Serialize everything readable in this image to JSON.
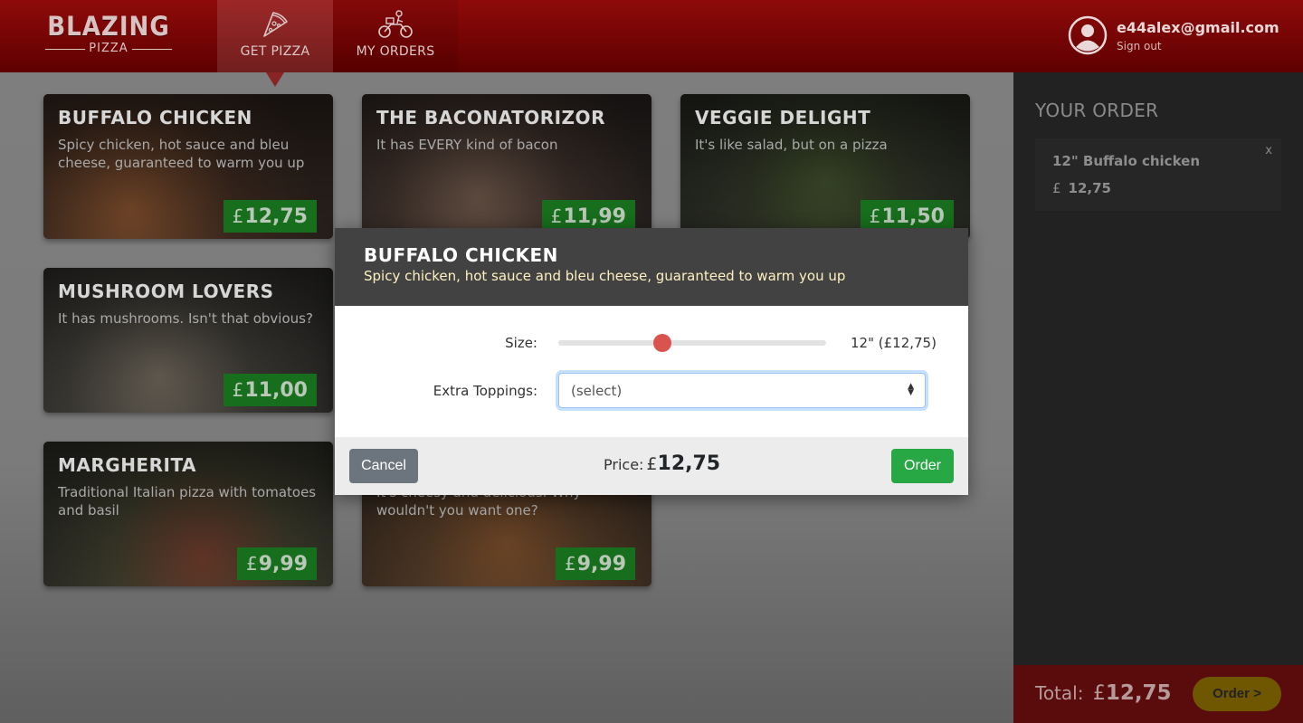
{
  "brand": {
    "top": "BLAZING",
    "bottom": "PIZZA"
  },
  "nav": {
    "get_pizza": "GET PIZZA",
    "my_orders": "MY ORDERS"
  },
  "user": {
    "email": "e44alex@gmail.com",
    "sign_out": "Sign out"
  },
  "specials": [
    {
      "name": "BUFFALO CHICKEN",
      "description": "Spicy chicken, hot sauce and bleu cheese, guaranteed to warm you up",
      "currency": "£",
      "price": "12,75"
    },
    {
      "name": "THE BACONATORIZOR",
      "description": "It has EVERY kind of bacon",
      "currency": "£",
      "price": "11,99"
    },
    {
      "name": "VEGGIE DELIGHT",
      "description": "It's like salad, but on a pizza",
      "currency": "£",
      "price": "11,50"
    },
    {
      "name": "MUSHROOM LOVERS",
      "description": "It has mushrooms. Isn't that obvious?",
      "currency": "£",
      "price": "11,00"
    },
    {
      "name": "MARGHERITA",
      "description": "Traditional Italian pizza with tomatoes and basil",
      "currency": "£",
      "price": "9,99"
    },
    {
      "name": "",
      "description": "It's cheesy and delicious. Why wouldn't you want one?",
      "currency": "£",
      "price": "9,99"
    }
  ],
  "order_panel": {
    "title": "YOUR ORDER",
    "items": [
      {
        "name": "12\" Buffalo chicken",
        "currency": "£",
        "price": "12,75",
        "remove": "x"
      }
    ],
    "total_label": "Total:",
    "total_currency": "£",
    "total": "12,75",
    "order_button": "Order >"
  },
  "dialog": {
    "title": "BUFFALO CHICKEN",
    "description": "Spicy chicken, hot sauce and bleu cheese, guaranteed to warm you up",
    "size_label": "Size:",
    "size_value": "12\" (£12,75)",
    "size_slider_fraction": 0.39,
    "toppings_label": "Extra Toppings:",
    "toppings_selected": "(select)",
    "cancel": "Cancel",
    "price_label": "Price:",
    "price_currency": "£",
    "price": "12,75",
    "order": "Order"
  },
  "colors": {
    "header_red": "#8f0a0a",
    "price_green": "#176e1c",
    "slider_thumb": "#d9534f",
    "order_green": "#28a745",
    "cancel_grey": "#6c757d",
    "checkout_gold": "#6f5600"
  },
  "icons": {
    "pizza_slice": "pizza-slice-icon",
    "motorbike": "motorbike-icon",
    "user": "user-circle-icon"
  }
}
